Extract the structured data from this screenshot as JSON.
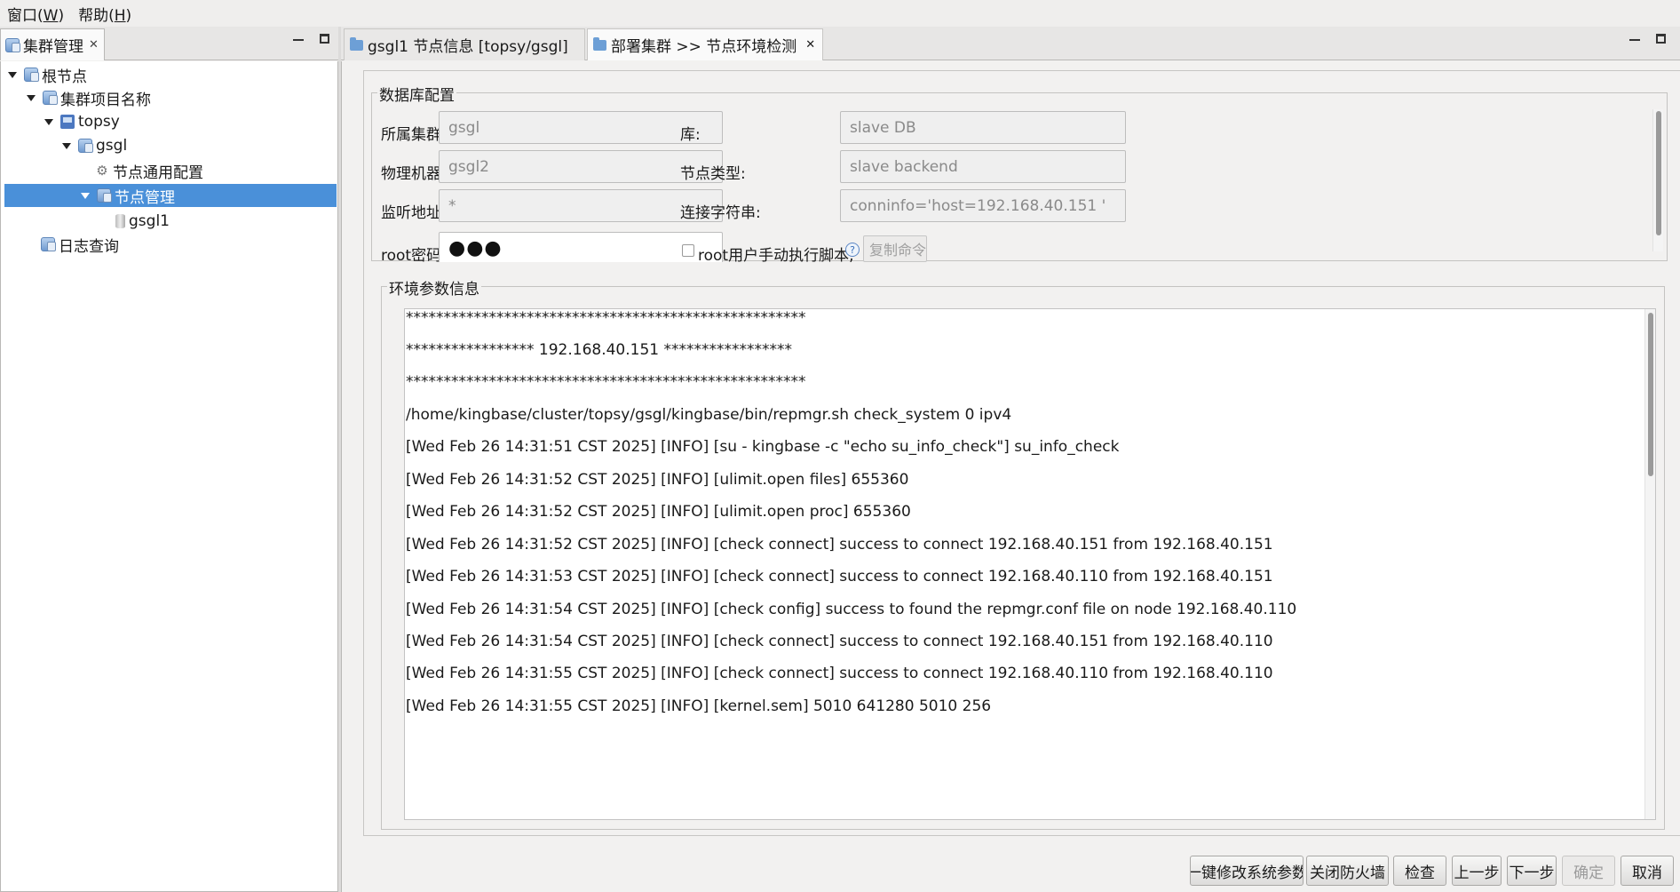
{
  "menubar": {
    "items": [
      {
        "label": "窗口(",
        "mnemonic": "W",
        "suffix": ")"
      },
      {
        "label": "帮助(",
        "mnemonic": "H",
        "suffix": ")"
      }
    ]
  },
  "left_panel": {
    "tab_label": "集群管理",
    "tree": [
      {
        "label": "根节点",
        "icon": "cluster-icon"
      },
      {
        "label": "集群项目名称",
        "icon": "cluster-icon"
      },
      {
        "label": "topsy",
        "icon": "host-icon"
      },
      {
        "label": "gsgl",
        "icon": "cluster-icon"
      },
      {
        "label": "节点通用配置",
        "icon": "gear-icon"
      },
      {
        "label": "节点管理",
        "icon": "cluster-icon"
      },
      {
        "label": "gsgl1",
        "icon": "database-node-icon"
      },
      {
        "label": "日志查询",
        "icon": "cluster-icon"
      }
    ]
  },
  "editor_tabs": [
    {
      "label": "gsgl1 节点信息 [topsy/gsgl]"
    },
    {
      "label": "部署集群 >> 节点环境检测"
    }
  ],
  "db_config": {
    "legend": "数据库配置",
    "cluster_label": "所属集群:",
    "cluster_value": "gsgl",
    "db_label": "库:",
    "db_value": "slave DB",
    "machine_label": "物理机器:",
    "machine_value": "gsgl2",
    "node_type_label": "节点类型:",
    "node_type_value": "slave backend",
    "listen_label": "监听地址:",
    "listen_value": "*",
    "conn_label": "连接字符串:",
    "conn_value": "conninfo='host=192.168.40.151 '",
    "root_pw_label": "root密码:",
    "root_pw_value": "●●●",
    "root_manual_label": "root用户手动执行脚本,",
    "copy_cmd_label": "复制命令"
  },
  "env_info": {
    "legend": "环境参数信息",
    "lines": [
      "*****************************************************",
      "***************** 192.168.40.151 *****************",
      "*****************************************************",
      "/home/kingbase/cluster/topsy/gsgl/kingbase/bin/repmgr.sh check_system 0 ipv4",
      "[Wed Feb 26 14:31:51 CST 2025] [INFO] [su - kingbase -c \"echo su_info_check\"] su_info_check",
      "[Wed Feb 26 14:31:52 CST 2025] [INFO] [ulimit.open files] 655360",
      "[Wed Feb 26 14:31:52 CST 2025] [INFO] [ulimit.open proc] 655360",
      "[Wed Feb 26 14:31:52 CST 2025] [INFO] [check connect] success to connect 192.168.40.151 from 192.168.40.151",
      "[Wed Feb 26 14:31:53 CST 2025] [INFO] [check connect] success to connect 192.168.40.110 from 192.168.40.151",
      "[Wed Feb 26 14:31:54 CST 2025] [INFO] [check config] success to found the repmgr.conf file on node 192.168.40.110",
      "[Wed Feb 26 14:31:54 CST 2025] [INFO] [check connect] success to connect 192.168.40.151 from 192.168.40.110",
      "[Wed Feb 26 14:31:55 CST 2025] [INFO] [check connect] success to connect 192.168.40.110 from 192.168.40.110",
      "[Wed Feb 26 14:31:55 CST 2025] [INFO] [kernel.sem] 5010 641280 5010 256"
    ]
  },
  "buttons": {
    "modify_system": "一键修改系统参数",
    "close_firewall": "关闭防火墙",
    "check": "检查",
    "prev": "上一步",
    "next": "下一步",
    "ok": "确定",
    "cancel": "取消"
  }
}
